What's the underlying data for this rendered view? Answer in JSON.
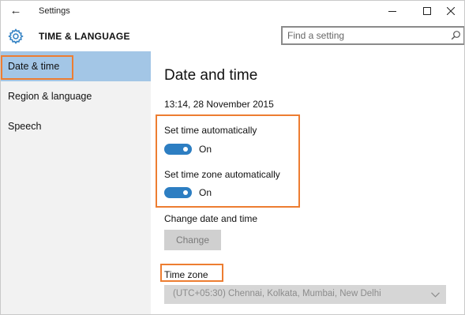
{
  "window": {
    "title": "Settings",
    "back_icon": "←",
    "minimize_icon": "minimize-icon",
    "maximize_icon": "maximize-icon",
    "close_icon": "close-icon"
  },
  "header": {
    "icon": "gear-icon",
    "title": "TIME & LANGUAGE",
    "search_placeholder": "Find a setting",
    "search_value": ""
  },
  "sidebar": {
    "items": [
      {
        "label": "Date & time",
        "selected": true
      },
      {
        "label": "Region & language",
        "selected": false
      },
      {
        "label": "Speech",
        "selected": false
      }
    ]
  },
  "main": {
    "title": "Date and time",
    "current_datetime": "13:14, 28 November 2015",
    "set_time_auto": {
      "label": "Set time automatically",
      "state": "On"
    },
    "set_tz_auto": {
      "label": "Set time zone automatically",
      "state": "On"
    },
    "change_label": "Change date and time",
    "change_button": "Change",
    "timezone_label": "Time zone",
    "timezone_value": "(UTC+05:30) Chennai, Kolkata, Mumbai, New Delhi"
  },
  "colors": {
    "accent": "#2d7ec2",
    "sidebar_selected": "#a3c6e6",
    "highlight": "#ed7d31"
  }
}
